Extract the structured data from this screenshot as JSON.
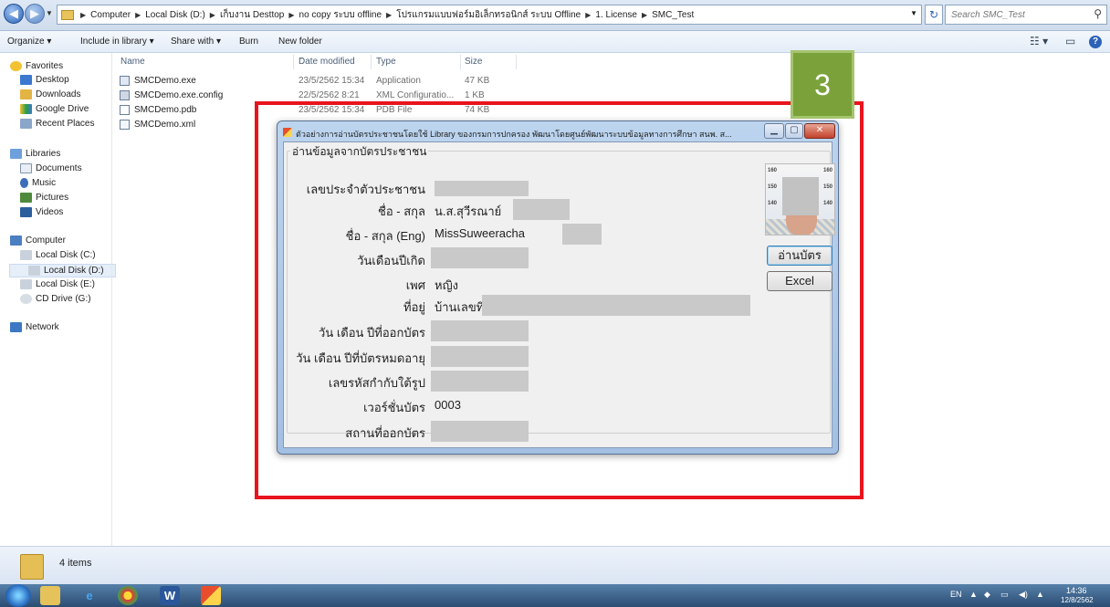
{
  "explorer": {
    "breadcrumb": [
      "Computer",
      "Local Disk (D:)",
      "เก็บงาน Desttop",
      "no copy ระบบ offline",
      "โปรแกรมแบบฟอร์มอิเล็กทรอนิกส์ ระบบ Offline",
      "1. License",
      "SMC_Test"
    ],
    "search_placeholder": "Search SMC_Test",
    "toolbar": {
      "organize": "Organize ▾",
      "include": "Include in library ▾",
      "share": "Share with ▾",
      "burn": "Burn",
      "new_folder": "New folder"
    },
    "nav": {
      "favorites": "Favorites",
      "desktop": "Desktop",
      "downloads": "Downloads",
      "google_drive": "Google Drive",
      "recent": "Recent Places",
      "libraries": "Libraries",
      "documents": "Documents",
      "music": "Music",
      "pictures": "Pictures",
      "videos": "Videos",
      "computer": "Computer",
      "disk_c": "Local Disk (C:)",
      "disk_d": "Local Disk (D:)",
      "disk_e": "Local Disk (E:)",
      "cd_g": "CD Drive (G:)",
      "network": "Network"
    },
    "columns": {
      "name": "Name",
      "modified": "Date modified",
      "type": "Type",
      "size": "Size"
    },
    "files": [
      {
        "name": "SMCDemo.exe",
        "modified": "23/5/2562 15:34",
        "type": "Application",
        "size": "47 KB"
      },
      {
        "name": "SMCDemo.exe.config",
        "modified": "22/5/2562 8:21",
        "type": "XML Configuratio...",
        "size": "1 KB"
      },
      {
        "name": "SMCDemo.pdb",
        "modified": "23/5/2562 15:34",
        "type": "PDB File",
        "size": "74 KB"
      },
      {
        "name": "SMCDemo.xml",
        "modified": "",
        "type": "",
        "size": ""
      }
    ],
    "status": "4 items"
  },
  "dialog": {
    "title": "ตัวอย่างการอ่านบัตรประชาชนโดยใช้ Library ของกรมการปกครอง พัฒนาโดยศูนย์พัฒนาระบบข้อมูลทางการศึกษา สนพ. ส...",
    "group_title": "อ่านข้อมูลจากบัตรประชาชน",
    "fields": {
      "citizen_id": "เลขประจำตัวประชาชน",
      "name_th": "ชื่อ - สกุล",
      "name_th_value": "น.ส.สุวีรณาย์",
      "name_en": "ชื่อ - สกุล (Eng)",
      "name_en_value": "MissSuweeracha",
      "birthdate": "วันเดือนปีเกิด",
      "sex": "เพศ",
      "sex_value": "หญิง",
      "address": "ที่อยู่",
      "address_value": "บ้านเลขที่",
      "issue_date": "วัน เดือน ปีที่ออกบัตร",
      "expire_date": "วัน เดือน ปีที่บัตรหมดอายุ",
      "photo_code": "เลขรหัสกำกับใต้รูป",
      "card_version": "เวอร์ชั่นบัตร",
      "card_version_value": "0003",
      "issuer": "สถานที่ออกบัตร"
    },
    "photo_scale": [
      "160",
      "160",
      "150",
      "150",
      "140",
      "140"
    ],
    "buttons": {
      "read": "อ่านบัตร",
      "excel": "Excel"
    }
  },
  "annotation": {
    "step": "3",
    "box_color": "#e8141e",
    "badge_color": "#7ba23a"
  },
  "taskbar": {
    "lang": "EN",
    "time": "14:36",
    "date": "12/8/2562"
  }
}
